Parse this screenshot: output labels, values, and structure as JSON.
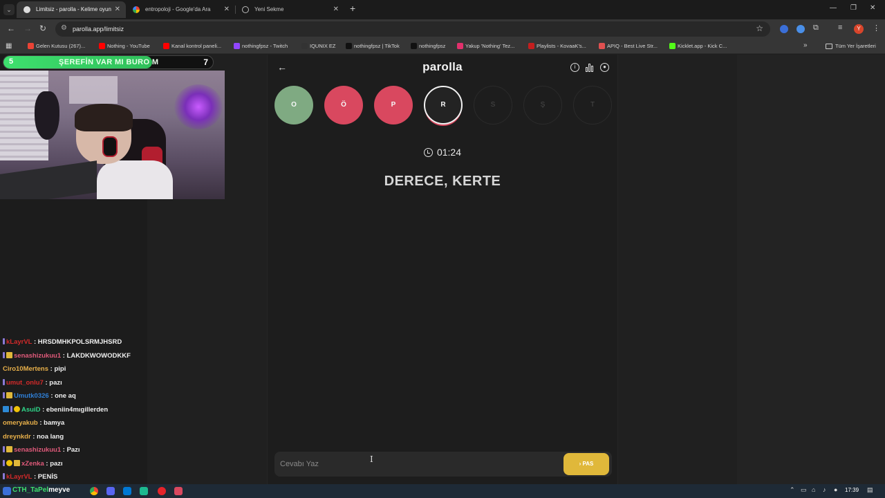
{
  "browser": {
    "tabs": [
      {
        "title": "Limitsiz - parolla - Kelime oyun",
        "active": true,
        "icon": "parolla-favicon"
      },
      {
        "title": "entropoloji - Google'da Ara",
        "active": false,
        "icon": "google-favicon"
      },
      {
        "title": "Yeni Sekme",
        "active": false,
        "icon": "globe-icon"
      }
    ],
    "url": "parolla.app/limitsiz",
    "profile_initial": "Y",
    "bookmarks": [
      {
        "label": "Gelen Kutusu (267)...",
        "color": "#ea4335"
      },
      {
        "label": "Nothing - YouTube",
        "color": "#ff0000"
      },
      {
        "label": "Kanal kontrol paneli...",
        "color": "#ff0000"
      },
      {
        "label": "nothingfpsz - Twitch",
        "color": "#9146ff"
      },
      {
        "label": "IQUNIX EZ",
        "color": "#333333"
      },
      {
        "label": "nothingfpsz | TikTok",
        "color": "#111111"
      },
      {
        "label": "nothingfpsz",
        "color": "#111111"
      },
      {
        "label": "Yakup 'Nothing' Tez...",
        "color": "#e1306c"
      },
      {
        "label": "Playlists - KovaaK's...",
        "color": "#c41e1e"
      },
      {
        "label": "APIQ - Best Live Str...",
        "color": "#e05050"
      },
      {
        "label": "Kicklet.app - Kick C...",
        "color": "#53fc18"
      }
    ],
    "all_bookmarks": "Tüm Yer İşaretleri"
  },
  "overlay": {
    "left_value": "5",
    "title": "ŞEREFİN VAR MI BURO M",
    "right_value": "7",
    "progress": 0.71
  },
  "game": {
    "logo": "parolla",
    "letters": [
      {
        "char": "O",
        "state": "correct"
      },
      {
        "char": "Ö",
        "state": "wrong"
      },
      {
        "char": "P",
        "state": "wrong"
      },
      {
        "char": "R",
        "state": "current"
      },
      {
        "char": "S",
        "state": "pending"
      },
      {
        "char": "Ş",
        "state": "pending"
      },
      {
        "char": "T",
        "state": "pending"
      }
    ],
    "timer": "01:24",
    "clue": "DERECE, KERTE",
    "answer_placeholder": "Cevabı Yaz",
    "answer_value": "",
    "pas_label": "PAS"
  },
  "chat": [
    {
      "user": "kLayrVL",
      "color": "#d42a2a",
      "badges": [
        "stick"
      ],
      "message": "HRSDMHKPOLSRMJHSRD"
    },
    {
      "user": "senashizukuu1",
      "color": "#e05a7a",
      "badges": [
        "stick",
        "sub"
      ],
      "message": "LAKDKWOWODKKF"
    },
    {
      "user": "Ciro10Mertens",
      "color": "#e8b04a",
      "badges": [],
      "message": "pipi"
    },
    {
      "user": "umut_onlu7",
      "color": "#d42a2a",
      "badges": [
        "stick"
      ],
      "message": "pazı"
    },
    {
      "user": "Umutk0326",
      "color": "#2f7fd6",
      "badges": [
        "stick",
        "sub"
      ],
      "message": "one aq"
    },
    {
      "user": "AsuiD",
      "color": "#2fd68a",
      "badges": [
        "mod",
        "stick",
        "warn"
      ],
      "message": "ebeniin4mıgillerden"
    },
    {
      "user": "omeryakub",
      "color": "#e8b04a",
      "badges": [],
      "message": "bamya"
    },
    {
      "user": "dreynkdr",
      "color": "#e8b04a",
      "badges": [],
      "message": "noa lang"
    },
    {
      "user": "senashizukuu1",
      "color": "#e05a7a",
      "badges": [
        "stick",
        "sub"
      ],
      "message": "Pazı"
    },
    {
      "user": "xZenka",
      "color": "#e05a7a",
      "badges": [
        "stick",
        "warn",
        "sub"
      ],
      "message": "pazı"
    },
    {
      "user": "kLayrVL",
      "color": "#d42a2a",
      "badges": [
        "stick"
      ],
      "message": "PENİS"
    }
  ],
  "taskbar": {
    "ticker_prefix": "CTH_TaPel",
    "ticker_suffix": "meyve",
    "time": "17:39"
  }
}
